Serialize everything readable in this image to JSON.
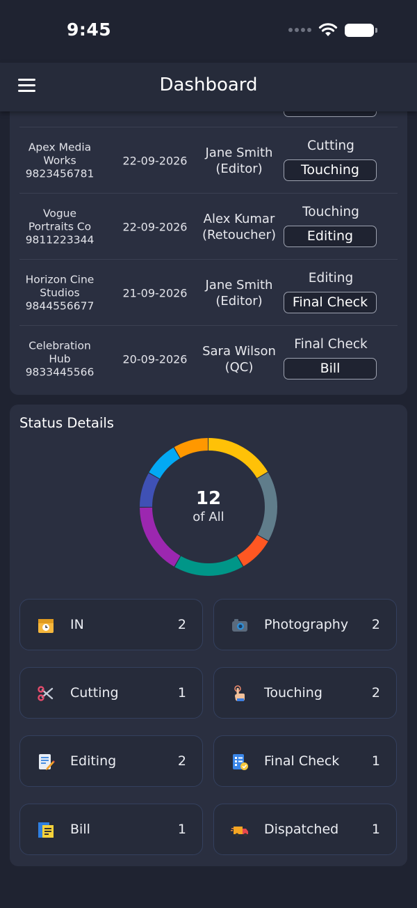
{
  "status_bar": {
    "time": "9:45"
  },
  "app_bar": {
    "title": "Dashboard"
  },
  "orders": [
    {
      "client": [
        "Apex Media",
        "Works",
        "9823456781"
      ],
      "date": "22-09-2026",
      "staff": [
        "Jane Smith",
        "(Editor)"
      ],
      "current_stage": "Cutting",
      "next_action": "Touching"
    },
    {
      "client": [
        "Vogue",
        "Portraits Co",
        "9811223344"
      ],
      "date": "22-09-2026",
      "staff": [
        "Alex Kumar",
        "(Retoucher)"
      ],
      "current_stage": "Touching",
      "next_action": "Editing"
    },
    {
      "client": [
        "Horizon Cine",
        "Studios",
        "9844556677"
      ],
      "date": "21-09-2026",
      "staff": [
        "Jane Smith",
        "(Editor)"
      ],
      "current_stage": "Editing",
      "next_action": "Final Check"
    },
    {
      "client": [
        "Celebration",
        "Hub",
        "9833445566"
      ],
      "date": "20-09-2026",
      "staff": [
        "Sara Wilson",
        "(QC)"
      ],
      "current_stage": "Final Check",
      "next_action": "Bill"
    }
  ],
  "status_details": {
    "title": "Status Details",
    "total": "12",
    "total_caption": "of All",
    "items": [
      {
        "label": "IN",
        "count": "2",
        "icon": "inbox-box-icon",
        "color": "#ffc107"
      },
      {
        "label": "Photography",
        "count": "2",
        "icon": "camera-icon",
        "color": "#607d8b"
      },
      {
        "label": "Cutting",
        "count": "1",
        "icon": "scissors-icon",
        "color": "#ff5722"
      },
      {
        "label": "Touching",
        "count": "2",
        "icon": "touch-hand-icon",
        "color": "#009688"
      },
      {
        "label": "Editing",
        "count": "2",
        "icon": "edit-document-icon",
        "color": "#9c27b0"
      },
      {
        "label": "Final Check",
        "count": "1",
        "icon": "checklist-icon",
        "color": "#3f51b5"
      },
      {
        "label": "Bill",
        "count": "1",
        "icon": "bill-icon",
        "color": "#03a9f4"
      },
      {
        "label": "Dispatched",
        "count": "1",
        "icon": "delivery-truck-icon",
        "color": "#ff9800"
      }
    ]
  }
}
